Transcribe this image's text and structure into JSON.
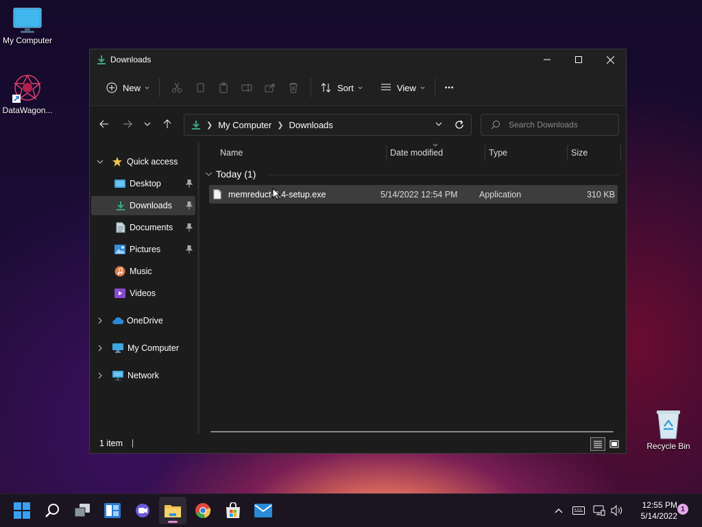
{
  "desktop": {
    "icons": [
      {
        "label": "My Computer"
      },
      {
        "label": "DataWagon..."
      },
      {
        "label": "Recycle Bin"
      }
    ]
  },
  "window": {
    "title": "Downloads",
    "toolbar": {
      "new_label": "New",
      "sort_label": "Sort",
      "view_label": "View",
      "more_label": "•••"
    },
    "address": {
      "crumbs": [
        "My Computer",
        "Downloads"
      ]
    },
    "search": {
      "placeholder": "Search Downloads"
    },
    "nav": {
      "quick_access": "Quick access",
      "items": [
        {
          "label": "Desktop",
          "pinned": true
        },
        {
          "label": "Downloads",
          "pinned": true,
          "selected": true
        },
        {
          "label": "Documents",
          "pinned": true
        },
        {
          "label": "Pictures",
          "pinned": true
        },
        {
          "label": "Music",
          "pinned": false
        },
        {
          "label": "Videos",
          "pinned": false
        }
      ],
      "onedrive": "OneDrive",
      "my_computer": "My Computer",
      "network": "Network"
    },
    "columns": {
      "name": "Name",
      "date": "Date modified",
      "type": "Type",
      "size": "Size"
    },
    "group": {
      "label": "Today (1)"
    },
    "files": [
      {
        "name": "memreduct-3.4-setup.exe",
        "date": "5/14/2022 12:54 PM",
        "type": "Application",
        "size": "310 KB"
      }
    ],
    "status": {
      "count": "1 item"
    }
  },
  "taskbar": {
    "time": "12:55 PM",
    "date": "5/14/2022",
    "notifications": "1"
  },
  "colors": {
    "accent": "#3aa97a",
    "selection": "#3d3d3d",
    "folder": "#f2c14e"
  }
}
